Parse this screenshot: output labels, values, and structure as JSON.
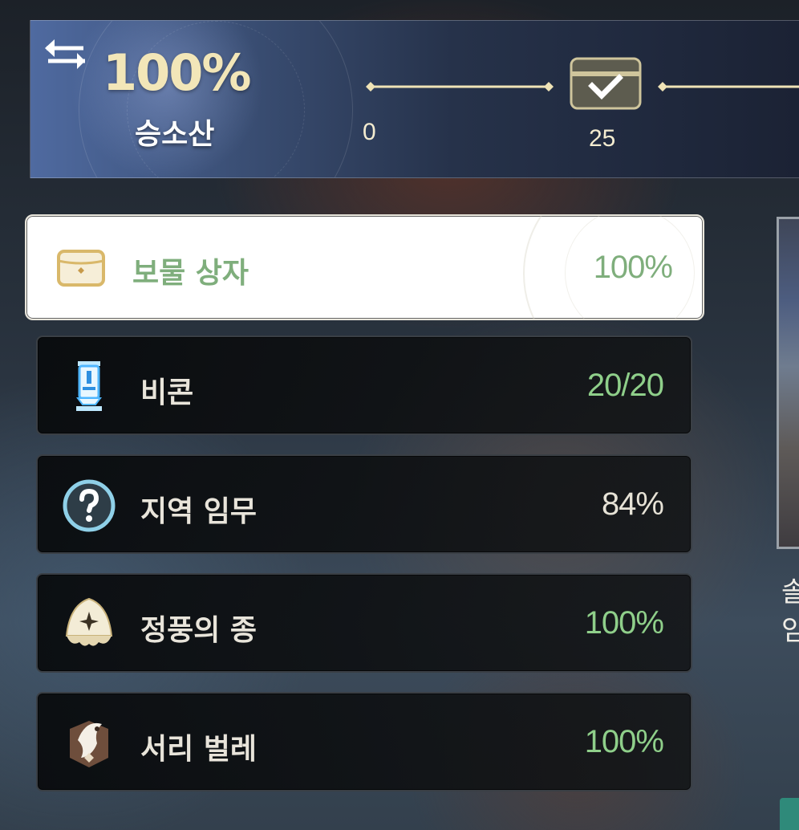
{
  "header": {
    "exploration_percent": "100%",
    "region_name": "승소산",
    "progress_ticks": [
      "0",
      "25"
    ],
    "milestone_reached": true
  },
  "categories": [
    {
      "label": "보물 상자",
      "value": "100%",
      "icon": "treasure-chest-icon",
      "selected": true,
      "complete": true
    },
    {
      "label": "비콘",
      "value": "20/20",
      "icon": "beacon-icon",
      "selected": false,
      "complete": true
    },
    {
      "label": "지역 임무",
      "value": "84%",
      "icon": "question-mark-icon",
      "selected": false,
      "complete": false
    },
    {
      "label": "정풍의 종",
      "value": "100%",
      "icon": "bell-icon",
      "selected": false,
      "complete": true
    },
    {
      "label": "서리 벌레",
      "value": "100%",
      "icon": "frost-bug-icon",
      "selected": false,
      "complete": true
    }
  ],
  "preview": {
    "caption_lines": [
      "솔",
      "임"
    ]
  },
  "colors": {
    "complete_green": "#8fcf8a",
    "selected_green": "#7fae7c",
    "gold": "#f2e6b8"
  }
}
